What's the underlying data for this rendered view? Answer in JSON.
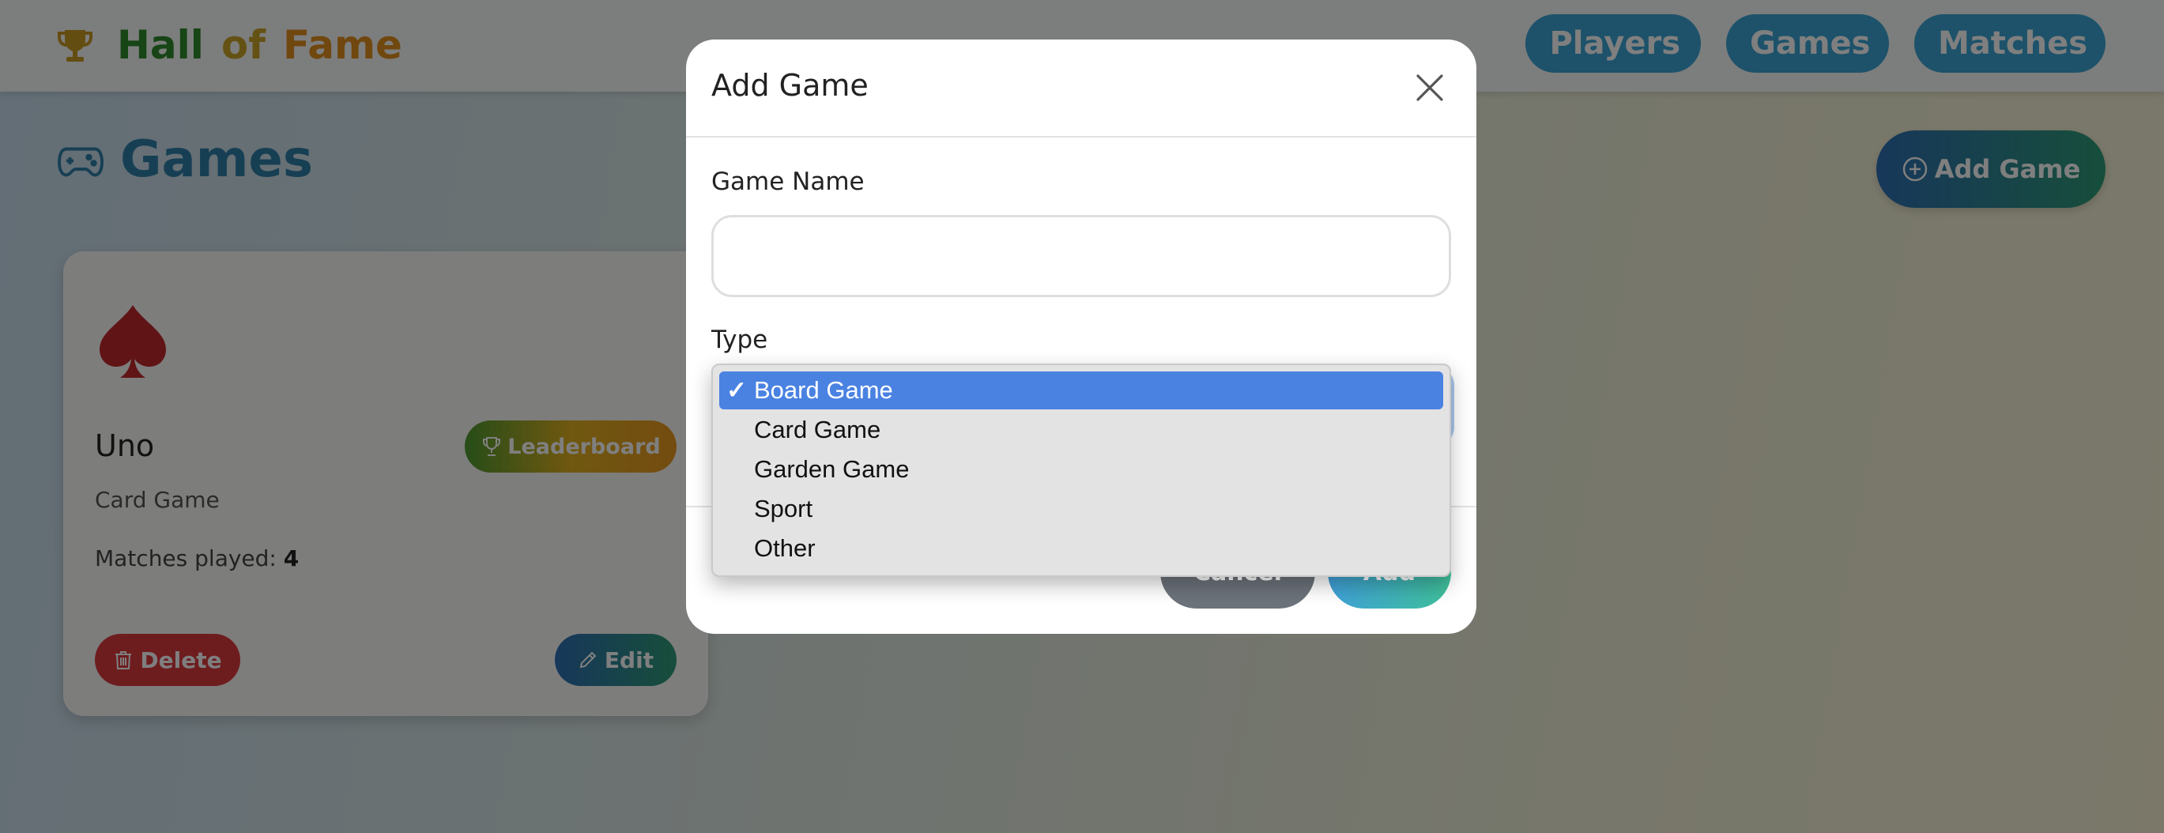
{
  "navbar": {
    "brand": {
      "word1": "Hall",
      "word2": "of",
      "word3": "Fame"
    },
    "links": [
      {
        "label": "Players",
        "icon": "people-icon"
      },
      {
        "label": "Games",
        "icon": "controller-icon"
      },
      {
        "label": "Matches",
        "icon": "list-icon"
      }
    ]
  },
  "page": {
    "title": "Games",
    "add_button": "Add Game"
  },
  "game_card": {
    "icon": "spade-icon",
    "name": "Uno",
    "type": "Card Game",
    "matches_label": "Matches played:",
    "matches_count": "4",
    "leaderboard_button": "Leaderboard",
    "delete_button": "Delete",
    "edit_button": "Edit"
  },
  "modal": {
    "title": "Add Game",
    "name_label": "Game Name",
    "name_value": "",
    "type_label": "Type",
    "type_options": [
      "Board Game",
      "Card Game",
      "Garden Game",
      "Sport",
      "Other"
    ],
    "type_selected": "Board Game",
    "checkmark": "✓",
    "cancel_button": "Cancel",
    "add_button": "Add"
  },
  "colors": {
    "brand_hall": "#2f8a2c",
    "brand_of": "#c9a528",
    "brand_fame": "#e08e1c",
    "nav_button": "#3ba4d4",
    "delete": "#dc3b3f",
    "dropdown_highlight": "#4a82e2"
  }
}
